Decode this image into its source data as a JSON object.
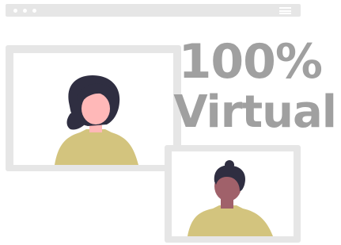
{
  "headline": {
    "line1": "100%",
    "line2": "Virtual"
  },
  "colors": {
    "frame": "#e6e6e6",
    "text": "#a0a0a0",
    "shirt": "#d3c47e",
    "skin_light": "#ffb8b8",
    "skin_dark": "#a0616a",
    "hair": "#2f2e41"
  },
  "icons": {
    "browser_dots": "three-dots-icon",
    "menu": "hamburger-icon"
  }
}
